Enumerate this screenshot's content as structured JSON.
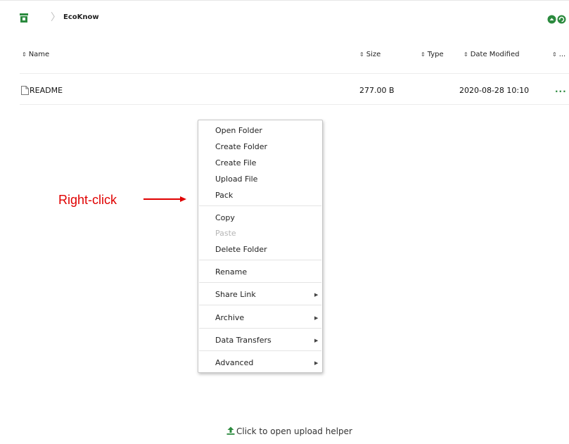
{
  "breadcrumb": {
    "root_icon": "home-drive-icon",
    "current": "EcoKnow"
  },
  "top_actions": {
    "icons": [
      "circle-up-icon",
      "refresh-icon"
    ],
    "color": "#2b8a3e"
  },
  "columns": {
    "name": "Name",
    "size": "Size",
    "type": "Type",
    "date": "Date Modified",
    "more": "..."
  },
  "files": [
    {
      "icon": "file-icon",
      "name": "README",
      "size": "277.00 B",
      "type": "",
      "date": "2020-08-28 10:10",
      "actions": "..."
    }
  ],
  "annotation": {
    "text": "Right-click",
    "color": "#e00000"
  },
  "context_menu": {
    "items": [
      {
        "label": "Open Folder"
      },
      {
        "label": "Create Folder"
      },
      {
        "label": "Create File"
      },
      {
        "label": "Upload File"
      },
      {
        "label": "Pack"
      },
      {
        "label": "Copy"
      },
      {
        "label": "Paste",
        "disabled": true
      },
      {
        "label": "Delete Folder"
      },
      {
        "label": "Rename"
      },
      {
        "label": "Share Link",
        "submenu": true
      },
      {
        "label": "Archive",
        "submenu": true
      },
      {
        "label": "Data Transfers",
        "submenu": true
      },
      {
        "label": "Advanced",
        "submenu": true
      }
    ]
  },
  "upload_helper": {
    "icon": "upload-icon",
    "text": "Click to open upload helper"
  }
}
